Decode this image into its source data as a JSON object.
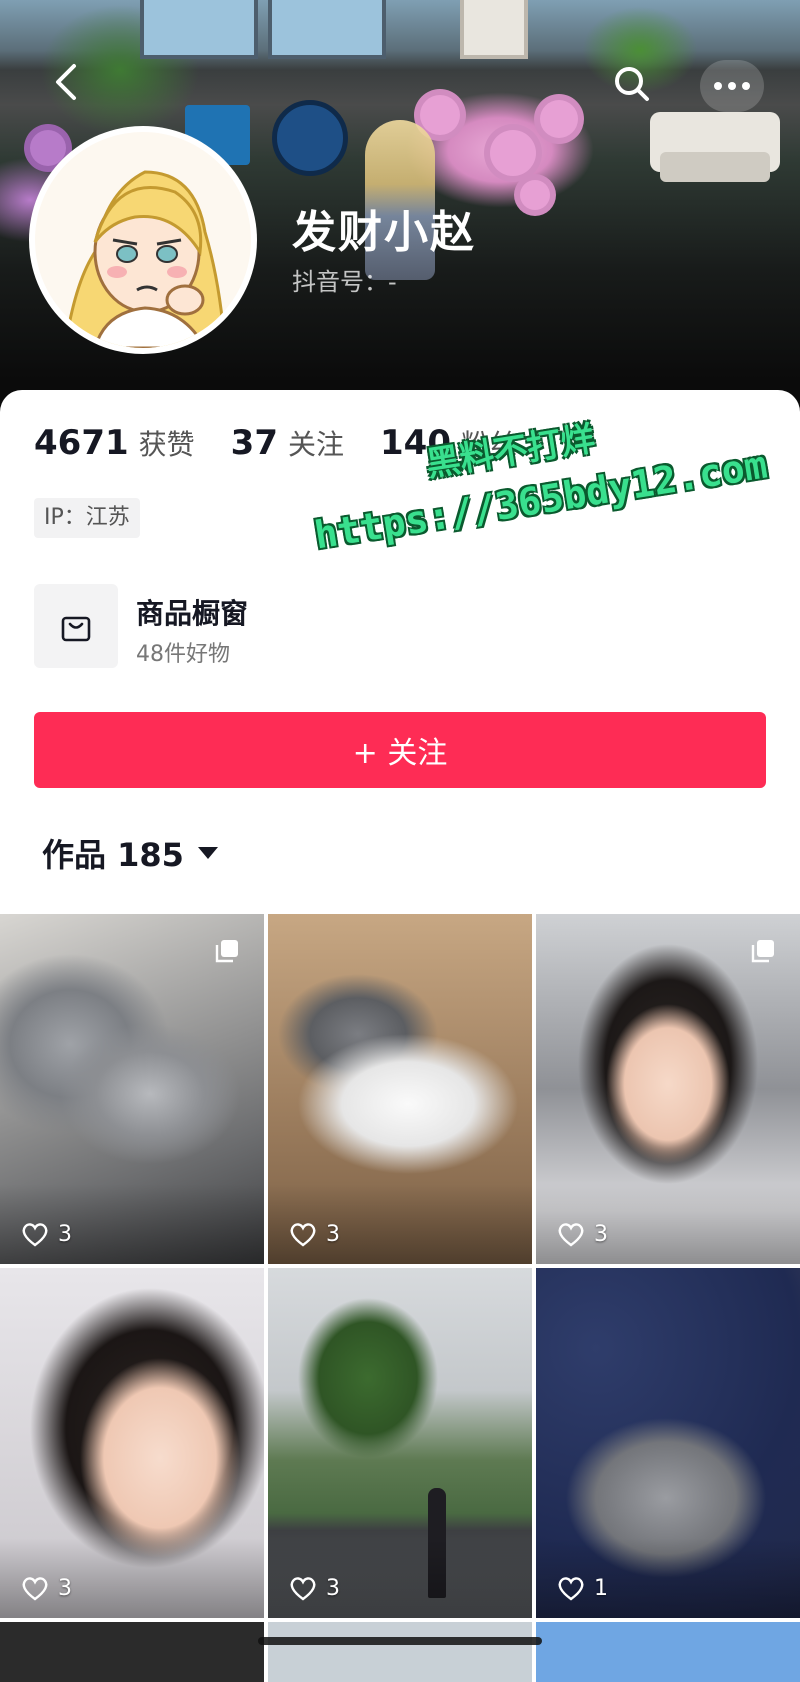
{
  "profile": {
    "name": "发财小赵",
    "douyin_id_label": "抖音号：-"
  },
  "stats": [
    {
      "value": "4671",
      "label": "获赞"
    },
    {
      "value": "37",
      "label": "关注"
    },
    {
      "value": "140",
      "label": "粉丝"
    }
  ],
  "ip_tag": "IP：江苏",
  "shop": {
    "title": "商品橱窗",
    "subtitle": "48件好物"
  },
  "follow_button": "+ 关注",
  "works": {
    "label": "作品 185"
  },
  "watermark": {
    "line1": "黑料不打烊",
    "line2": "https://365bdy12.com"
  },
  "grid_items": [
    {
      "likes": "3",
      "multi": true
    },
    {
      "likes": "3",
      "multi": false
    },
    {
      "likes": "3",
      "multi": true
    },
    {
      "likes": "3",
      "multi": false
    },
    {
      "likes": "3",
      "multi": false
    },
    {
      "likes": "1",
      "multi": false
    }
  ],
  "colors": {
    "accent": "#fe2c55",
    "watermark": "#39e08e"
  }
}
